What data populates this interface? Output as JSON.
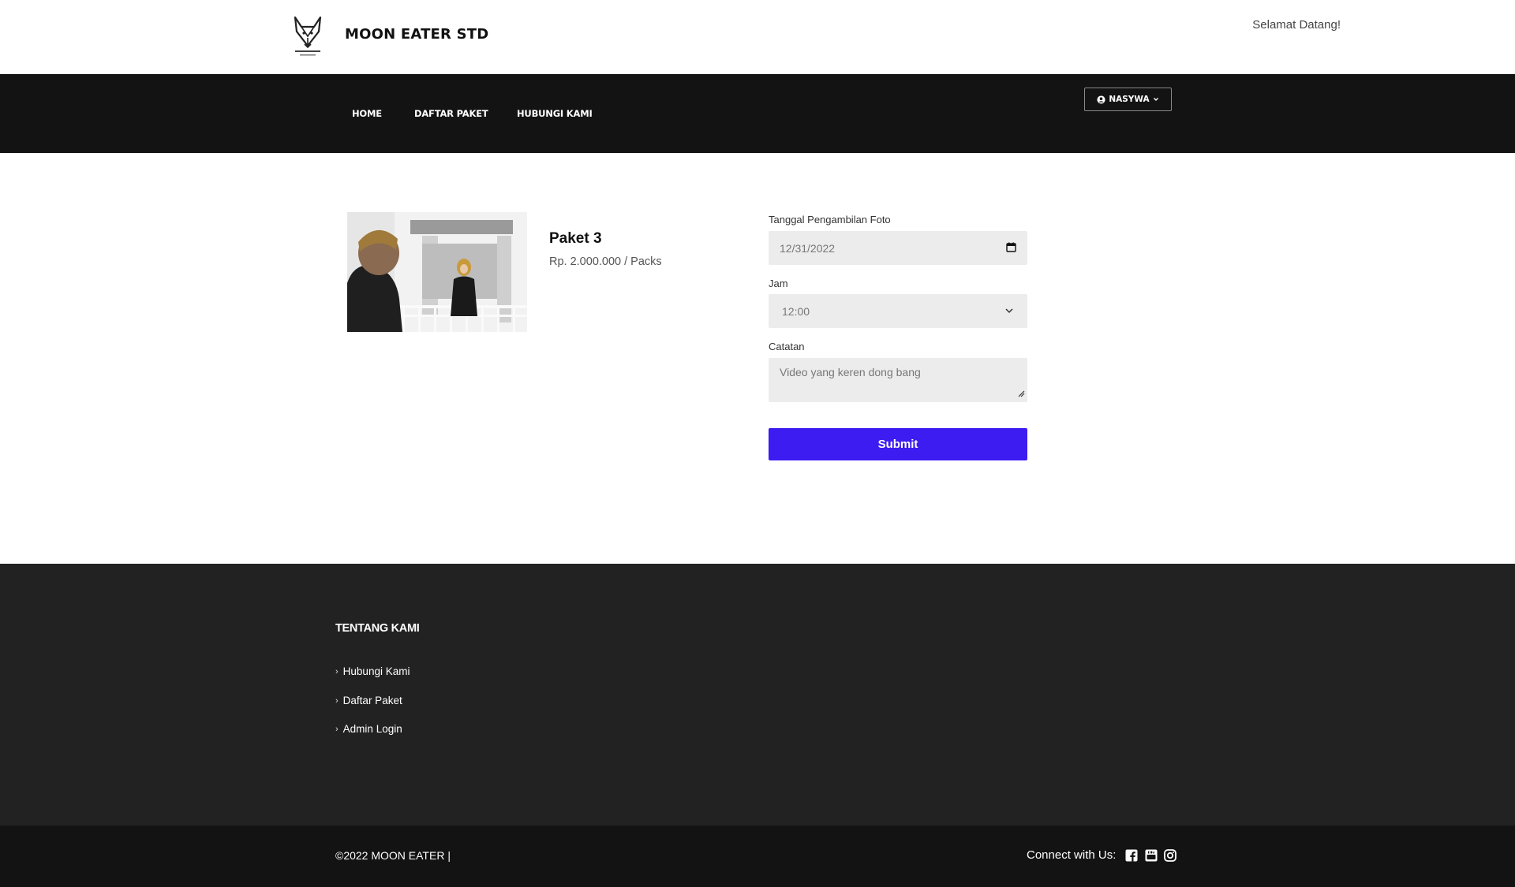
{
  "header": {
    "brand": "MOON EATER STD",
    "welcome": "Selamat Datang!"
  },
  "nav": {
    "items": [
      {
        "label": "HOME"
      },
      {
        "label": "DAFTAR PAKET"
      },
      {
        "label": "HUBUNGI KAMI"
      }
    ],
    "user": {
      "label": "NASYWA",
      "icon": "user-circle-icon"
    }
  },
  "product": {
    "title": "Paket 3",
    "price": "Rp. 2.000.000 / Packs"
  },
  "form": {
    "date_label": "Tanggal Pengambilan Foto",
    "date_value": "12/31/2022",
    "jam_label": "Jam",
    "jam_value": "12:00",
    "catatan_label": "Catatan",
    "catatan_value": "Video yang keren dong bang",
    "submit_label": "Submit",
    "submit_color": "#3d1cf2"
  },
  "footer": {
    "heading": "TENTANG KAMI",
    "links": [
      {
        "label": "Hubungi Kami"
      },
      {
        "label": "Daftar Paket"
      },
      {
        "label": "Admin Login"
      }
    ],
    "copyright": "©2022 MOON EATER |",
    "connect_label": "Connect with Us:",
    "social_icons": [
      "facebook-icon",
      "youtube-icon",
      "instagram-icon"
    ]
  },
  "colors": {
    "nav_bg": "#131313",
    "footer_bg": "#222222",
    "field_bg": "#ececec"
  }
}
